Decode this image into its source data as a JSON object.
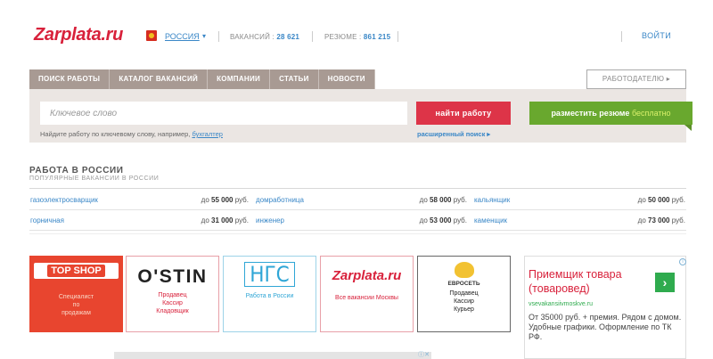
{
  "header": {
    "logo": "Zarplata.ru",
    "region": "РОССИЯ",
    "region_caret": "▾",
    "vacancies_label": "ВАКАНСИЙ :",
    "vacancies_count": "28 621",
    "resumes_label": "РЕЗЮМЕ :",
    "resumes_count": "861 215",
    "login": "ВОЙТИ"
  },
  "nav": {
    "items": [
      {
        "label": "ПОИСК РАБОТЫ"
      },
      {
        "label": "КАТАЛОГ ВАКАНСИЙ"
      },
      {
        "label": "КОМПАНИИ"
      },
      {
        "label": "СТАТЬИ"
      },
      {
        "label": "НОВОСТИ"
      }
    ],
    "employer": "РАБОТОДАТЕЛЮ ▸"
  },
  "search": {
    "placeholder": "Ключевое слово",
    "find_button": "найти работу",
    "resume_button": "разместить резюме",
    "resume_free": "бесплатно",
    "hint_text": "Найдите работу по ключевому слову, например,",
    "hint_example": "бухгалтер",
    "advanced": "расширенный поиск ▸"
  },
  "section": {
    "title": "РАБОТА В РОССИИ",
    "subtitle": "ПОПУЛЯРНЫЕ ВАКАНСИИ В РОССИИ"
  },
  "vacancies": [
    [
      {
        "name": "газоэлектросварщик",
        "prefix": "до",
        "amount": "55 000",
        "unit": "руб."
      },
      {
        "name": "домработница",
        "prefix": "до",
        "amount": "58 000",
        "unit": "руб."
      },
      {
        "name": "кальянщик",
        "prefix": "до",
        "amount": "50 000",
        "unit": "руб."
      }
    ],
    [
      {
        "name": "горничная",
        "prefix": "до",
        "amount": "31 000",
        "unit": "руб."
      },
      {
        "name": "инженер",
        "prefix": "до",
        "amount": "53 000",
        "unit": "руб."
      },
      {
        "name": "каменщик",
        "prefix": "до",
        "amount": "73 000",
        "unit": "руб."
      }
    ]
  ],
  "banners": {
    "topshop": {
      "logo": "TOP SHOP",
      "lines": [
        "Специалист",
        "по",
        "продажам"
      ]
    },
    "ostin": {
      "logo": "O'STIN",
      "lines": [
        "Продавец",
        "Кассир",
        "Кладовщик"
      ]
    },
    "ngs": {
      "logo": "НГС",
      "lines": [
        "Работа в России"
      ]
    },
    "zarplata": {
      "logo": "Zarplata.ru",
      "lines": [
        "Все вакансии Москвы"
      ]
    },
    "evroset": {
      "logo": "ЕВРОСЕТЬ",
      "lines": [
        "Продавец",
        "Кассир",
        "Курьер"
      ]
    }
  },
  "ad": {
    "title": "Приемщик товара (товаровед)",
    "url": "vsevakansiivmoskve.ru",
    "body": "От 35000 руб. + премия. Рядом с домом. Удобные графики. Оформление по ТК РФ."
  },
  "colors": {
    "brand_red": "#d8213b",
    "link_blue": "#3a87c7",
    "nav_bg": "#a89a93",
    "find_button": "#dd3448",
    "resume_button": "#69a82e"
  }
}
